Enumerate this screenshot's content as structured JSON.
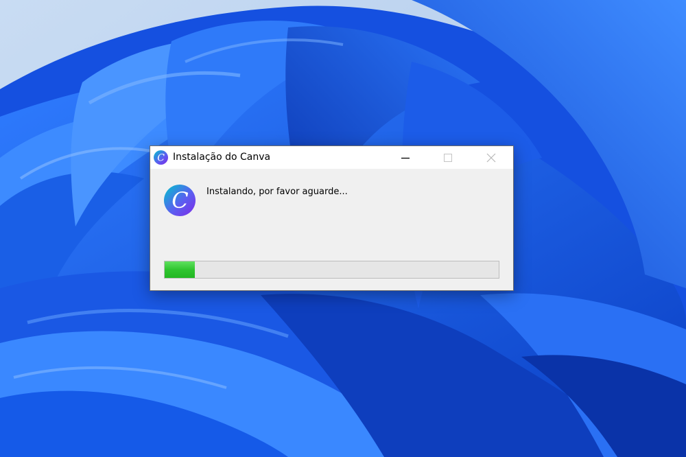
{
  "window": {
    "title": "Instalação do Canva",
    "logo_letter": "C",
    "controls": {
      "minimize_icon": "minimize-icon",
      "maximize_icon": "maximize-icon",
      "close_icon": "close-icon"
    }
  },
  "content": {
    "logo_letter": "C",
    "message": "Instalando, por favor aguarde...",
    "progress_fraction": 0.09
  },
  "colors": {
    "desktop_blue": "#1a56d6",
    "progress_green": "#2fc52f",
    "canva_cyan": "#00c4cc",
    "canva_purple": "#7d2ae8"
  }
}
